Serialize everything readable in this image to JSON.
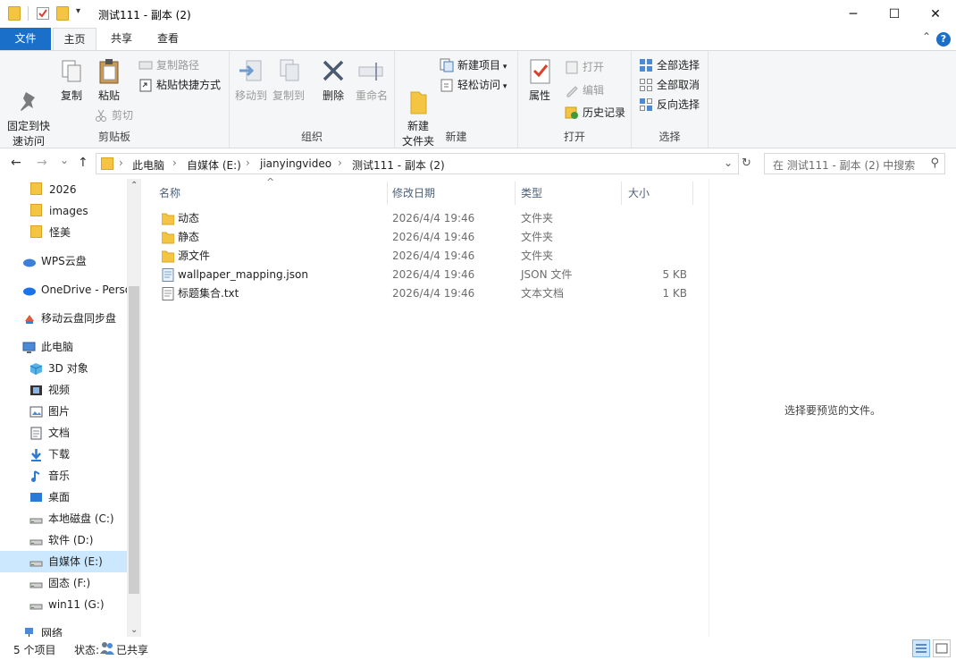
{
  "window": {
    "title": "测试111 - 副本 (2)",
    "minimize_glyph": "─",
    "maximize_glyph": "☐",
    "close_glyph": "✕",
    "qa_dropdown_glyph": "▾"
  },
  "ribbon_tabs": [
    "文件",
    "主页",
    "共享",
    "查看"
  ],
  "ribbon_collapse_glyph": "⌃",
  "help_glyph": "?",
  "ribbon": {
    "clipboard": {
      "label": "剪贴板",
      "pin": "固定到快\n速访问",
      "copy": "复制",
      "paste": "粘贴",
      "copy_path": "复制路径",
      "paste_shortcut": "粘贴快捷方式",
      "cut": "剪切"
    },
    "organize": {
      "label": "组织",
      "move_to": "移动到",
      "copy_to": "复制到",
      "delete": "删除",
      "rename": "重命名"
    },
    "new": {
      "label": "新建",
      "new_folder": "新建\n文件夹",
      "new_item": "新建项目",
      "easy_access": "轻松访问"
    },
    "open": {
      "label": "打开",
      "properties": "属性",
      "open": "打开",
      "edit": "编辑",
      "history": "历史记录"
    },
    "select": {
      "label": "选择",
      "select_all": "全部选择",
      "select_none": "全部取消",
      "invert": "反向选择"
    }
  },
  "nav_glyphs": {
    "back": "←",
    "forward": "→",
    "recent": "⌄",
    "up": "↑",
    "addr_dropdown": "⌄",
    "refresh": "↻",
    "search": "⚲",
    "crumb_sep": "›",
    "scroll_up": "⌃",
    "scroll_down": "⌄"
  },
  "address": {
    "crumbs": [
      "此电脑",
      "自媒体 (E:)",
      "jianyingvideo",
      "测试111 - 副本 (2)"
    ]
  },
  "search": {
    "placeholder": "在 测试111 - 副本 (2) 中搜索"
  },
  "navpane": {
    "items": [
      {
        "label": "2026",
        "icon": "folder-icon"
      },
      {
        "label": "images",
        "icon": "folder-icon"
      },
      {
        "label": "怪美",
        "icon": "folder-icon"
      },
      {
        "label": "WPS云盘",
        "icon": "cloud-icon"
      },
      {
        "label": "OneDrive - Personal",
        "icon": "onedrive-icon"
      },
      {
        "label": "移动云盘同步盘",
        "icon": "sync-icon"
      },
      {
        "label": "此电脑",
        "icon": "computer-icon"
      },
      {
        "label": "3D 对象",
        "icon": "cube-icon"
      },
      {
        "label": "视频",
        "icon": "video-icon"
      },
      {
        "label": "图片",
        "icon": "picture-icon"
      },
      {
        "label": "文档",
        "icon": "document-icon"
      },
      {
        "label": "下载",
        "icon": "download-icon"
      },
      {
        "label": "音乐",
        "icon": "music-icon"
      },
      {
        "label": "桌面",
        "icon": "desktop-icon"
      },
      {
        "label": "本地磁盘 (C:)",
        "icon": "drive-icon"
      },
      {
        "label": "软件 (D:)",
        "icon": "drive-icon"
      },
      {
        "label": "自媒体 (E:)",
        "icon": "drive-icon"
      },
      {
        "label": "固态 (F:)",
        "icon": "drive-icon"
      },
      {
        "label": "win11 (G:)",
        "icon": "drive-icon"
      },
      {
        "label": "网络",
        "icon": "network-icon"
      }
    ]
  },
  "filelist": {
    "columns": [
      "名称",
      "修改日期",
      "类型",
      "大小"
    ],
    "sort_glyph": "^",
    "rows": [
      {
        "name": "动态",
        "date": "2026/4/4 19:46",
        "type": "文件夹",
        "size": "",
        "icon": "folder-icon"
      },
      {
        "name": "静态",
        "date": "2026/4/4 19:46",
        "type": "文件夹",
        "size": "",
        "icon": "folder-icon"
      },
      {
        "name": "源文件",
        "date": "2026/4/4 19:46",
        "type": "文件夹",
        "size": "",
        "icon": "folder-icon"
      },
      {
        "name": "wallpaper_mapping.json",
        "date": "2026/4/4 19:46",
        "type": "JSON 文件",
        "size": "5 KB",
        "icon": "json-file-icon"
      },
      {
        "name": "标题集合.txt",
        "date": "2026/4/4 19:46",
        "type": "文本文档",
        "size": "1 KB",
        "icon": "text-file-icon"
      }
    ]
  },
  "preview": {
    "message": "选择要预览的文件。"
  },
  "status": {
    "count": "5 个项目",
    "state_label": "状态:",
    "state_value": "已共享"
  },
  "colors": {
    "accent": "#1a6fc9",
    "selection": "#cce8ff",
    "folder": "#f4c542"
  }
}
